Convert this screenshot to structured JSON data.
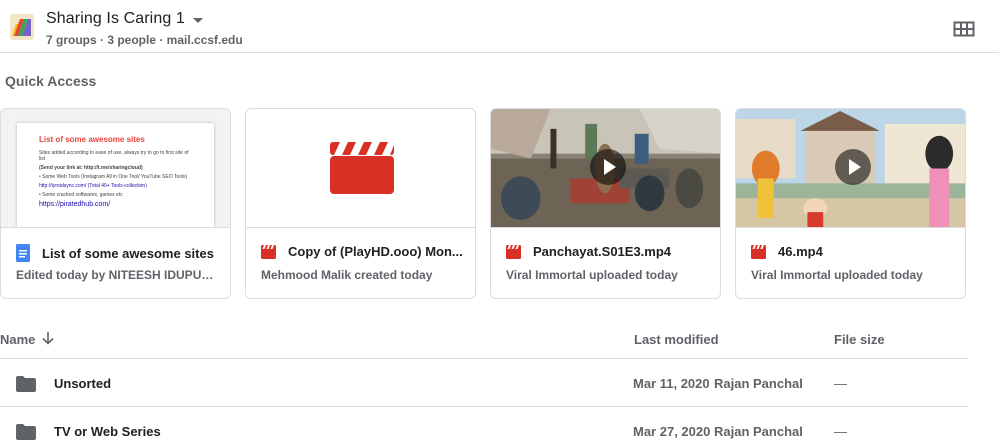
{
  "header": {
    "title": "Sharing Is Caring 1",
    "subtitle": "7 groups · 3 people · mail.ccsf.edu"
  },
  "quick_access": {
    "title": "Quick Access",
    "cards": [
      {
        "name": "List of some awesome sites",
        "meta": "Edited today by NITEESH IDUPULA...",
        "type_icon": "google-docs-icon",
        "preview": {
          "heading": "List of some awesome sites",
          "lines": [
            "Sites added according to ease of use, always try to go to first site of list",
            "(Send your link at: http://t.me/sharingcloud)",
            "• Some Web Tools (Instagram All in One Tool/ YouTube SEO Tools)",
            "http://tyroidsync.com/ (Total 40+ Tools-collection)",
            "• Some cracked softwares, games etc"
          ],
          "link": "https://piratedhub.com/"
        }
      },
      {
        "name": "Copy of (PlayHD.ooo) Mon...",
        "meta": "Mehmood Malik created today",
        "type_icon": "video-file-icon"
      },
      {
        "name": "Panchayat.S01E3.mp4",
        "meta": "Viral Immortal uploaded today",
        "type_icon": "video-file-icon"
      },
      {
        "name": "46.mp4",
        "meta": "Viral Immortal uploaded today",
        "type_icon": "video-file-icon"
      }
    ]
  },
  "list": {
    "columns": {
      "name": "Name",
      "modified": "Last modified",
      "size": "File size"
    },
    "rows": [
      {
        "name": "Unsorted",
        "date": "Mar 11, 2020",
        "owner": "Rajan Panchal",
        "size": "—"
      },
      {
        "name": "TV or Web Series",
        "date": "Mar 27, 2020",
        "owner": "Rajan Panchal",
        "size": "—"
      }
    ]
  },
  "colors": {
    "accent_red": "#d93025",
    "docs_blue": "#4285f4",
    "divider": "#dadce0"
  }
}
